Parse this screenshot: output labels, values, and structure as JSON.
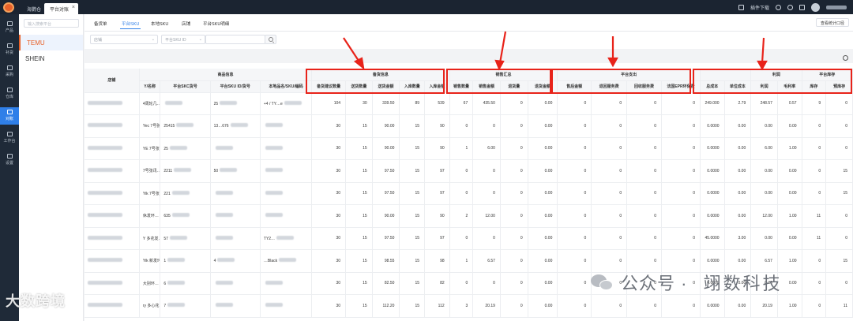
{
  "titlebar": {
    "tabs": [
      {
        "label": "海鹦仓"
      },
      {
        "label": "平台对账"
      }
    ],
    "plugin_download": "插件下载"
  },
  "leftnav": {
    "items": [
      {
        "label": "产品"
      },
      {
        "label": "补货"
      },
      {
        "label": "采购"
      },
      {
        "label": "仓库"
      },
      {
        "label": "对账"
      },
      {
        "label": "工作台"
      },
      {
        "label": "设置"
      }
    ]
  },
  "platforms": {
    "search_placeholder": "输入搜索平台",
    "items": [
      {
        "label": "TEMU"
      },
      {
        "label": "SHEIN"
      }
    ]
  },
  "main": {
    "tabs": [
      {
        "label": "备货单"
      },
      {
        "label": "平台SKU"
      },
      {
        "label": "本地SKU"
      },
      {
        "label": "店铺"
      },
      {
        "label": "平台SKU明细"
      }
    ],
    "stats_button": "查看统计口径",
    "filter": {
      "store_placeholder": "店铺",
      "sku_type": "平台SKU ID"
    }
  },
  "table": {
    "group_headers": {
      "product": "商品信息",
      "stock": "备货信息",
      "sales": "销售汇总",
      "platform_pay": "平台支出",
      "profit": "利润",
      "platform_stock": "平台库存"
    },
    "col_headers": {
      "store": "店铺",
      "name": "Y/名称",
      "skc": "平台SKC货号",
      "sku": "平台SKU ID/货号",
      "local": "本地品名/SKU/编码",
      "suggest": "备货建议数量",
      "ship_qty": "送货数量",
      "ship_amt": "送货金额",
      "in_qty": "入库数量",
      "in_amt": "入库金额",
      "sale_qty": "销售数量",
      "sale_amt": "销售金额",
      "ret_qty": "退货量",
      "ret_amt": "退货金额",
      "after_sale": "售后金额",
      "return_fee": "退回服务费",
      "recycle_fee": "回收服务费",
      "epr_fee": "法国EPR环保费",
      "total_cost": "总成本",
      "unit_cost": "单位成本",
      "profit": "利润",
      "margin": "毛利率",
      "stock": "库存",
      "pre_stock": "预库存"
    },
    "rows": [
      {
        "name": "4周轮几…",
        "skc": "",
        "sku": "25",
        "local": "+4 / TY…e",
        "suggest": "104",
        "ship_qty": "30",
        "ship_amt": "339.50",
        "in_qty": "89",
        "in_amt": "539",
        "sale_qty": "67",
        "sale_amt": "435.50",
        "ret_qty": "0",
        "ret_amt": "0.00",
        "after_sale": "0",
        "return_fee": "0",
        "recycle_fee": "0",
        "epr_fee": "0",
        "total_cost": "249.000",
        "unit_cost": "2.79",
        "profit": "248.57",
        "margin": "0.57",
        "stock": "9",
        "pre_stock": "0"
      },
      {
        "name": "Yec 7号张讯…",
        "skc": "25415",
        "sku": "13…676",
        "local": "",
        "suggest": "30",
        "ship_qty": "15",
        "ship_amt": "90.00",
        "in_qty": "15",
        "in_amt": "90",
        "sale_qty": "0",
        "sale_amt": "0",
        "ret_qty": "0",
        "ret_amt": "0.00",
        "after_sale": "0",
        "return_fee": "0",
        "recycle_fee": "0",
        "epr_fee": "0",
        "total_cost": "0.0000",
        "unit_cost": "0.00",
        "profit": "0.00",
        "margin": "0.00",
        "stock": "0",
        "pre_stock": "0"
      },
      {
        "name": "YE 7号张讯…",
        "skc": "25",
        "sku": "",
        "local": "",
        "suggest": "30",
        "ship_qty": "15",
        "ship_amt": "90.00",
        "in_qty": "15",
        "in_amt": "90",
        "sale_qty": "1",
        "sale_amt": "6.00",
        "ret_qty": "0",
        "ret_amt": "0.00",
        "after_sale": "0",
        "return_fee": "0",
        "recycle_fee": "0",
        "epr_fee": "0",
        "total_cost": "0.0000",
        "unit_cost": "0.00",
        "profit": "6.00",
        "margin": "1.00",
        "stock": "0",
        "pre_stock": "0"
      },
      {
        "name": "7号张讯…",
        "skc": "2211",
        "sku": "50",
        "local": "",
        "suggest": "30",
        "ship_qty": "15",
        "ship_amt": "97.50",
        "in_qty": "15",
        "in_amt": "97",
        "sale_qty": "0",
        "sale_amt": "0",
        "ret_qty": "0",
        "ret_amt": "0.00",
        "after_sale": "0",
        "return_fee": "0",
        "recycle_fee": "0",
        "epr_fee": "0",
        "total_cost": "0.0000",
        "unit_cost": "0.00",
        "profit": "0.00",
        "margin": "0.00",
        "stock": "0",
        "pre_stock": "15"
      },
      {
        "name": "Yik 7号张讯…",
        "skc": "221",
        "sku": "",
        "local": "",
        "suggest": "30",
        "ship_qty": "15",
        "ship_amt": "97.50",
        "in_qty": "15",
        "in_amt": "97",
        "sale_qty": "0",
        "sale_amt": "0",
        "ret_qty": "0",
        "ret_amt": "0.00",
        "after_sale": "0",
        "return_fee": "0",
        "recycle_fee": "0",
        "epr_fee": "0",
        "total_cost": "0.0000",
        "unit_cost": "0.00",
        "profit": "0.00",
        "margin": "0.00",
        "stock": "0",
        "pre_stock": "15"
      },
      {
        "name": "休发环…",
        "skc": "635",
        "sku": "",
        "local": "",
        "suggest": "30",
        "ship_qty": "15",
        "ship_amt": "90.00",
        "in_qty": "15",
        "in_amt": "90",
        "sale_qty": "2",
        "sale_amt": "12.00",
        "ret_qty": "0",
        "ret_amt": "0.00",
        "after_sale": "0",
        "return_fee": "0",
        "recycle_fee": "0",
        "epr_fee": "0",
        "total_cost": "0.0000",
        "unit_cost": "0.00",
        "profit": "12.00",
        "margin": "1.00",
        "stock": "11",
        "pre_stock": "0"
      },
      {
        "name": "Y 多花发…",
        "skc": "57",
        "sku": "",
        "local": "TY2…",
        "suggest": "30",
        "ship_qty": "15",
        "ship_amt": "97.50",
        "in_qty": "15",
        "in_amt": "97",
        "sale_qty": "0",
        "sale_amt": "0",
        "ret_qty": "0",
        "ret_amt": "0.00",
        "after_sale": "0",
        "return_fee": "0",
        "recycle_fee": "0",
        "epr_fee": "0",
        "total_cost": "45.0000",
        "unit_cost": "3.00",
        "profit": "0.00",
        "margin": "0.00",
        "stock": "11",
        "pre_stock": "0"
      },
      {
        "name": "Yik 新发环…",
        "skc": "1",
        "sku": "4",
        "local": "…Black",
        "suggest": "30",
        "ship_qty": "15",
        "ship_amt": "98.55",
        "in_qty": "15",
        "in_amt": "98",
        "sale_qty": "1",
        "sale_amt": "6.57",
        "ret_qty": "0",
        "ret_amt": "0.00",
        "after_sale": "0",
        "return_fee": "0",
        "recycle_fee": "0",
        "epr_fee": "0",
        "total_cost": "0.0000",
        "unit_cost": "0.00",
        "profit": "6.57",
        "margin": "1.00",
        "stock": "0",
        "pre_stock": "15"
      },
      {
        "name": "大别环…",
        "skc": "6",
        "sku": "",
        "local": "",
        "suggest": "30",
        "ship_qty": "15",
        "ship_amt": "82.50",
        "in_qty": "15",
        "in_amt": "82",
        "sale_qty": "0",
        "sale_amt": "0",
        "ret_qty": "0",
        "ret_amt": "0.00",
        "after_sale": "0",
        "return_fee": "0",
        "recycle_fee": "0",
        "epr_fee": "0",
        "total_cost": "0.0000",
        "unit_cost": "0.00",
        "profit": "0.00",
        "margin": "0.00",
        "stock": "0",
        "pre_stock": "0"
      },
      {
        "name": "ry 多心花…",
        "skc": "7",
        "sku": "",
        "local": "",
        "suggest": "30",
        "ship_qty": "15",
        "ship_amt": "112.20",
        "in_qty": "15",
        "in_amt": "112",
        "sale_qty": "3",
        "sale_amt": "20.19",
        "ret_qty": "0",
        "ret_amt": "0.00",
        "after_sale": "0",
        "return_fee": "0",
        "recycle_fee": "0",
        "epr_fee": "0",
        "total_cost": "0.0000",
        "unit_cost": "0.00",
        "profit": "20.19",
        "margin": "1.00",
        "stock": "0",
        "pre_stock": "11"
      }
    ]
  },
  "watermarks": {
    "left": "大数跨境",
    "right_label": "公众号 ·",
    "right_brand": "翊数科技"
  },
  "colors": {
    "accent": "#2f7fe8",
    "brand": "#e8622a",
    "highlight": "#e8231a",
    "nav_bg": "#1f2a38"
  }
}
